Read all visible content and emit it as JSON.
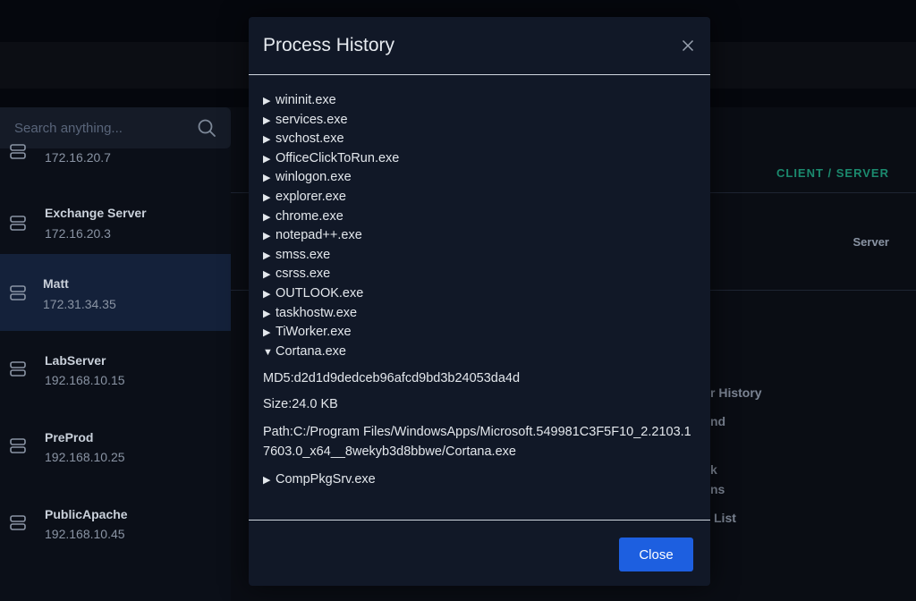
{
  "sidebar": {
    "search_placeholder": "Search anything...",
    "hosts": [
      {
        "name": "",
        "ip": "172.16.20.7"
      },
      {
        "name": "Exchange Server",
        "ip": "172.16.20.3"
      },
      {
        "name": "Matt",
        "ip": "172.31.34.35"
      },
      {
        "name": "LabServer",
        "ip": "192.168.10.15"
      },
      {
        "name": "PreProd",
        "ip": "192.168.10.25"
      },
      {
        "name": "PublicApache",
        "ip": "192.168.10.45"
      }
    ]
  },
  "main": {
    "column_header": "CLIENT / SERVER",
    "row_type": "Server",
    "fragments": [
      "r History",
      "nd",
      "k",
      "ns",
      "List"
    ]
  },
  "modal": {
    "title": "Process History",
    "processes": [
      "wininit.exe",
      "services.exe",
      "svchost.exe",
      "OfficeClickToRun.exe",
      "winlogon.exe",
      "explorer.exe",
      "chrome.exe",
      "notepad++.exe",
      "smss.exe",
      "csrss.exe",
      "OUTLOOK.exe",
      "taskhostw.exe",
      "TiWorker.exe"
    ],
    "expanded": {
      "name": "Cortana.exe",
      "md5": "MD5:d2d1d9dedceb96afcd9bd3b24053da4d",
      "size": "Size:24.0 KB",
      "path": "Path:C:/Program Files/WindowsApps/Microsoft.549981C3F5F10_2.2103.17603.0_x64__8wekyb3d8bbwe/Cortana.exe"
    },
    "after": [
      "CompPkgSrv.exe"
    ],
    "close_label": "Close"
  },
  "colors": {
    "accent": "#1d5fe0",
    "teal": "#1b8a6e",
    "modal_bg": "#111827",
    "selected_row": "#14213a"
  },
  "icons": {
    "collapsed": "▶",
    "expanded": "▼"
  }
}
